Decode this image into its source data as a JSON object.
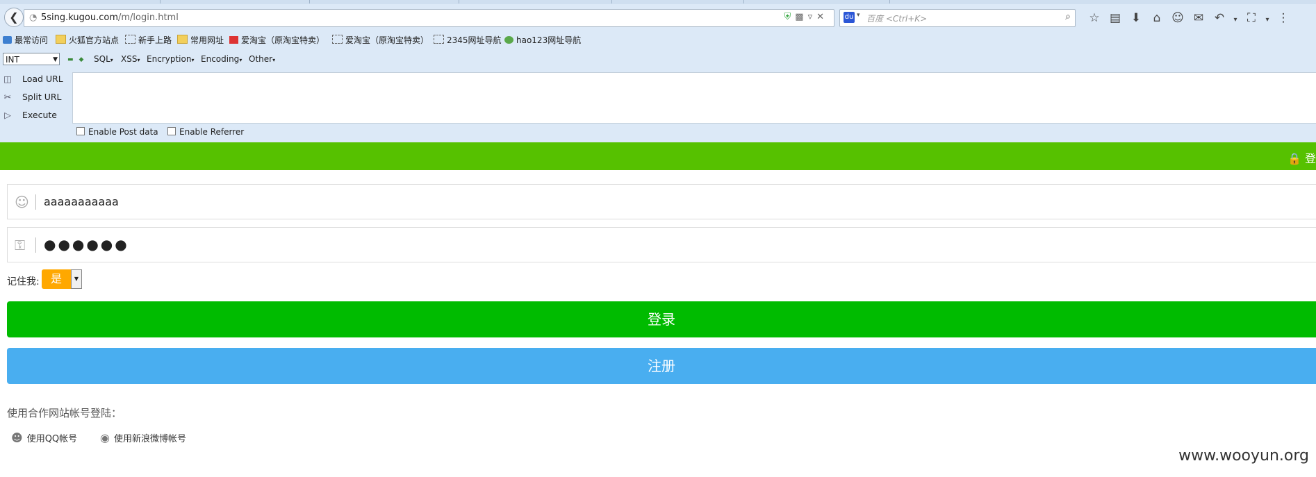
{
  "browser": {
    "url_domain": "5sing.kugou.com",
    "url_path": "/m/login.html",
    "search_placeholder": "百度 <Ctrl+K>",
    "search_engine_label": "du"
  },
  "bookmarks": [
    {
      "label": "最常访问",
      "icon": "most-visited-icon"
    },
    {
      "label": "火狐官方站点",
      "icon": "folder-icon"
    },
    {
      "label": "新手上路",
      "icon": "page-icon"
    },
    {
      "label": "常用网址",
      "icon": "folder-icon"
    },
    {
      "label": "爱淘宝（原淘宝特卖）",
      "icon": "taobao-icon"
    },
    {
      "label": "爱淘宝（原淘宝特卖）",
      "icon": "page-icon"
    },
    {
      "label": "2345网址导航",
      "icon": "page-icon"
    },
    {
      "label": "hao123网址导航",
      "icon": "hao123-icon"
    }
  ],
  "hackbar": {
    "select_value": "INT",
    "menus": [
      "SQL",
      "XSS",
      "Encryption",
      "Encoding",
      "Other"
    ],
    "load_url": "Load URL",
    "split_url": "Split URL",
    "execute": "Execute",
    "enable_post": "Enable Post data",
    "enable_referrer": "Enable Referrer"
  },
  "page": {
    "header_login_text": "登",
    "username_value": "aaaaaaaaaaa",
    "password_mask": "●●●●●●",
    "remember_label": "记住我:",
    "remember_value": "是",
    "login_button": "登录",
    "register_button": "注册",
    "partner_text": "使用合作网站帐号登陆：",
    "qq_login": "使用QQ帐号",
    "weibo_login": "使用新浪微博帐号",
    "watermark": "www.wooyun.org"
  },
  "colors": {
    "header_green": "#56c100",
    "login_green": "#00bb00",
    "register_blue": "#49aef0",
    "remember_orange": "#ffa800"
  }
}
